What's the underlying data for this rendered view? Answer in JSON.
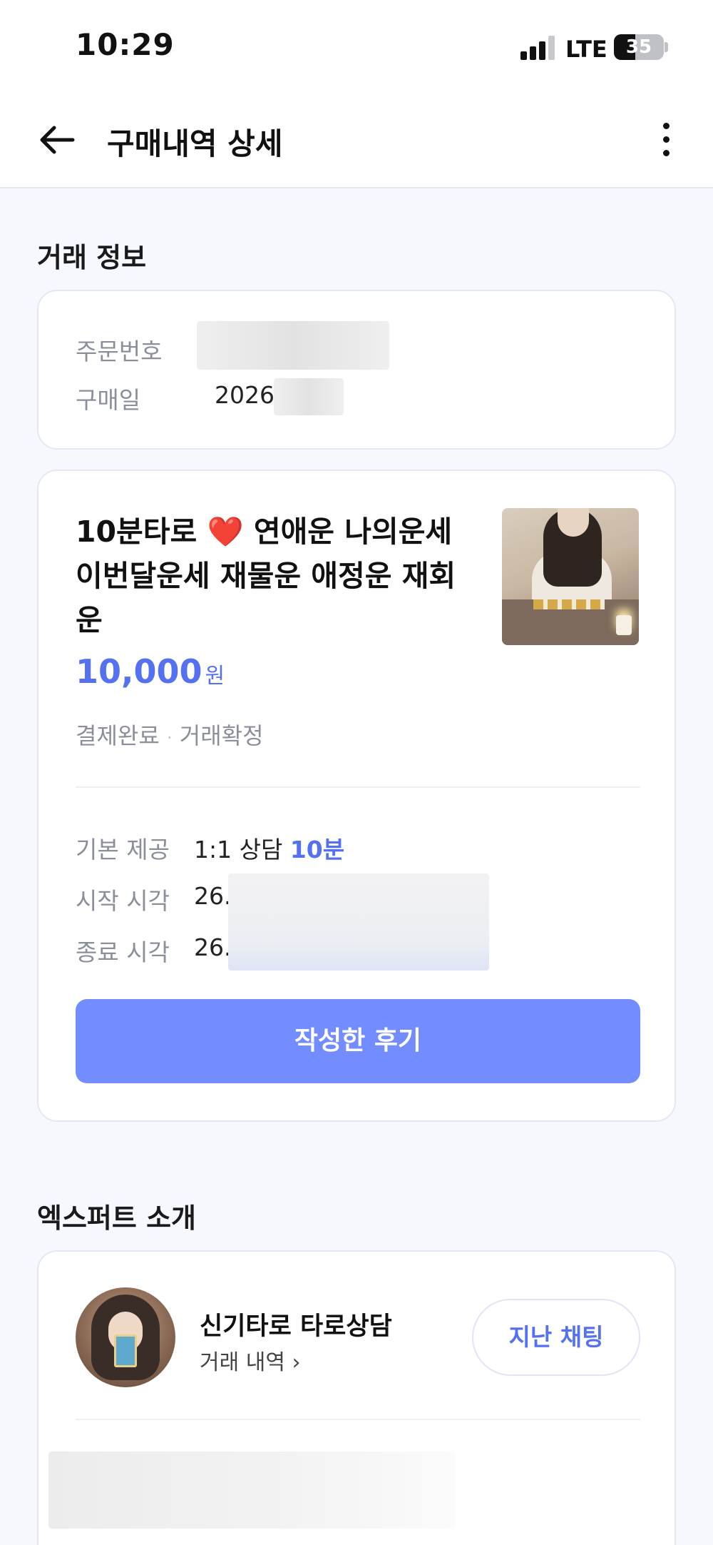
{
  "status_bar": {
    "time": "10:29",
    "network": "LTE",
    "battery": "35"
  },
  "nav": {
    "title": "구매내역 상세"
  },
  "trade_info": {
    "section_title": "거래 정보",
    "order_number_label": "주문번호",
    "purchase_date_label": "구매일",
    "purchase_date_value": "2026"
  },
  "product": {
    "title_part1": "10분타로",
    "heart": "❤️",
    "title_part2": "연애운 나의운세 이번달운세 재물운 애정운 재회운",
    "price": "10,000",
    "currency": "원",
    "payment_status": "결제완료",
    "separator": "·",
    "trade_status": "거래확정",
    "basic_label": "기본 제공",
    "basic_value": "1:1 상담",
    "basic_duration": "10분",
    "start_label": "시작 시각",
    "start_value": "26.",
    "end_label": "종료 시각",
    "end_value": "26.",
    "review_button": "작성한 후기"
  },
  "expert": {
    "section_title": "엑스퍼트 소개",
    "name": "신기타로 타로상담",
    "trade_history_link": "거래 내역",
    "chevron": "›",
    "past_chat_button": "지난 채팅"
  }
}
